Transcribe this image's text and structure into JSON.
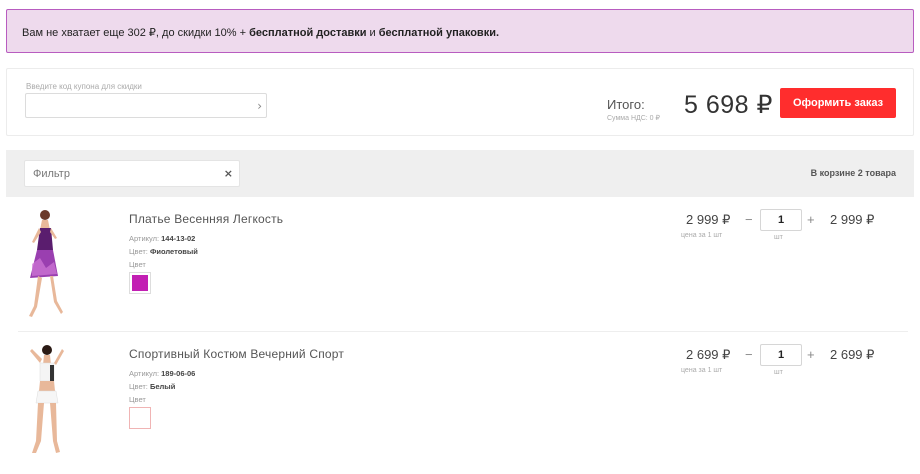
{
  "notice": {
    "prefix": "Вам не хватает еще 302 ₽, до скидки 10% + ",
    "free_delivery": "бесплатной доставки",
    "conj": " и ",
    "free_packaging": "бесплатной упаковки."
  },
  "summary": {
    "coupon_label": "Введите код купона для скидки",
    "coupon_placeholder": "",
    "coupon_arrow": "›",
    "total_label": "Итого:",
    "vat_note": "Сумма НДС: 0 ₽",
    "total_value": "5 698 ₽",
    "order_button": "Оформить заказ"
  },
  "cart_header": {
    "filter_placeholder": "Фильтр",
    "filter_clear": "×",
    "count_text": "В корзине 2 товара"
  },
  "items": [
    {
      "name": "Платье Весенняя Легкость",
      "article_label": "Артикул:",
      "article": "144-13-02",
      "color_label": "Цвет:",
      "color_name": "Фиолетовый",
      "swatch_label": "Цвет",
      "swatch_color": "#c21fb3",
      "price": "2 999 ₽",
      "price_note": "цена за 1 шт",
      "minus": "−",
      "qty": "1",
      "qty_unit": "шт",
      "plus": "+",
      "sum": "2 999 ₽"
    },
    {
      "name": "Спортивный Костюм Вечерний Спорт",
      "article_label": "Артикул:",
      "article": "189-06-06",
      "color_label": "Цвет:",
      "color_name": "Белый",
      "swatch_label": "Цвет",
      "swatch_color": "#ffffff",
      "price": "2 699 ₽",
      "price_note": "цена за 1 шт",
      "minus": "−",
      "qty": "1",
      "qty_unit": "шт",
      "plus": "+",
      "sum": "2 699 ₽"
    }
  ],
  "colors": {
    "notice_bg": "#eedaed",
    "notice_border": "#b85cc0",
    "accent_red": "#ff2d2d"
  }
}
